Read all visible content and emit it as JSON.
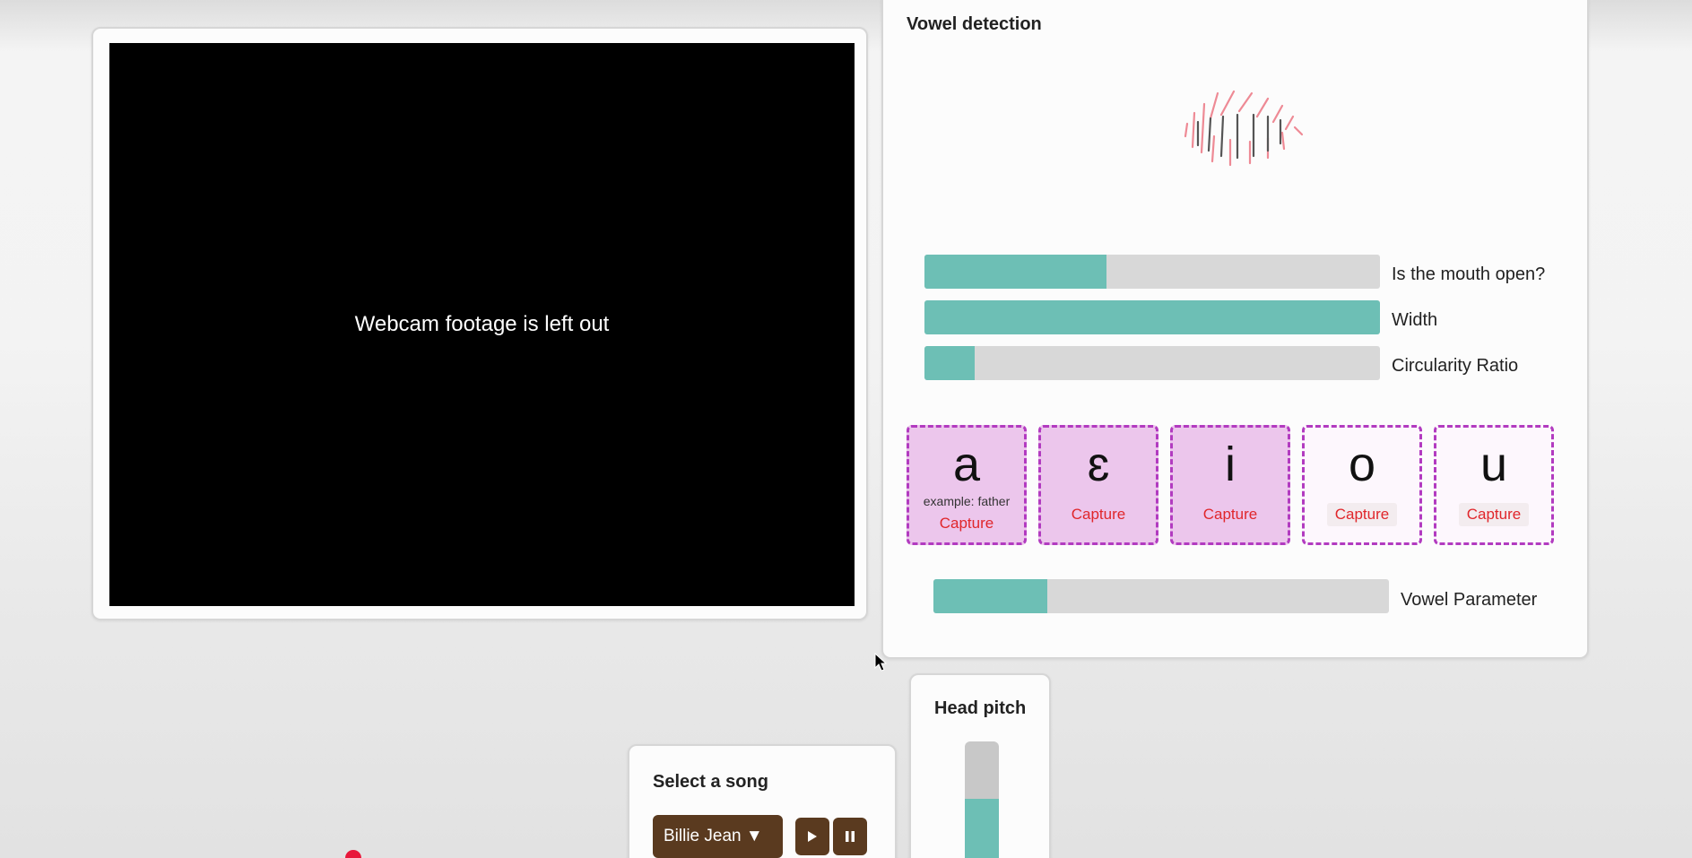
{
  "webcam": {
    "placeholder_text": "Webcam footage is left out"
  },
  "vowel_detection": {
    "title": "Vowel detection",
    "bars": {
      "mouth_open": {
        "label": "Is the mouth open?",
        "level": 0.4
      },
      "width": {
        "label": "Width",
        "level": 1.0
      },
      "circularity": {
        "label": "Circularity Ratio",
        "level": 0.11
      }
    },
    "vowels": [
      {
        "glyph": "a",
        "example": "example: father",
        "capture_label": "Capture",
        "state": "captured"
      },
      {
        "glyph": "ɛ",
        "example": "",
        "capture_label": "Capture",
        "state": "captured"
      },
      {
        "glyph": "i",
        "example": "",
        "capture_label": "Capture",
        "state": "captured"
      },
      {
        "glyph": "o",
        "example": "",
        "capture_label": "Capture",
        "state": "empty"
      },
      {
        "glyph": "u",
        "example": "",
        "capture_label": "Capture",
        "state": "empty"
      }
    ],
    "vowel_parameter": {
      "label": "Vowel Parameter",
      "level": 0.25
    }
  },
  "head_pitch": {
    "title": "Head pitch",
    "level": 0.6
  },
  "song": {
    "title": "Select a song",
    "selected": "Billie Jean ▼",
    "play_icon": "play-icon",
    "pause_icon": "pause-icon"
  },
  "colors": {
    "bar_fill": "#6dbfb5",
    "accent_brown": "#5a3a1f",
    "capture_red": "#e0262b",
    "vowel_border": "#b23bc0"
  }
}
